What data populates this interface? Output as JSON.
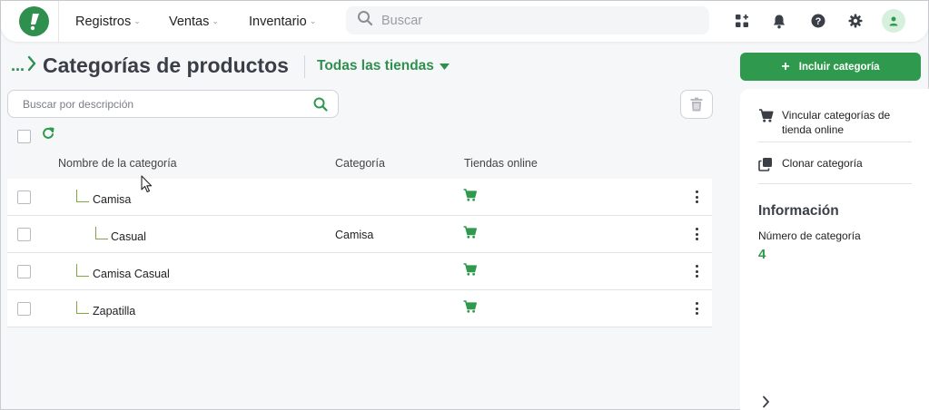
{
  "nav": {
    "items": [
      {
        "label": "Registros"
      },
      {
        "label": "Ventas"
      },
      {
        "label": "Inventario"
      }
    ],
    "search_placeholder": "Buscar"
  },
  "page": {
    "breadcrumb_ellipsis": "...",
    "title": "Categorías de productos",
    "store_filter": "Todas las tiendas"
  },
  "list": {
    "search_placeholder": "Buscar por descripción",
    "columns": [
      "Nombre de la categoría",
      "Categoría",
      "Tiendas online"
    ],
    "rows": [
      {
        "name": "Camisa",
        "level": 1,
        "parent": "",
        "online": true
      },
      {
        "name": "Casual",
        "level": 2,
        "parent": "Camisa",
        "online": true
      },
      {
        "name": "Camisa Casual",
        "level": 1,
        "parent": "",
        "online": true
      },
      {
        "name": "Zapatilla",
        "level": 1,
        "parent": "",
        "online": true
      }
    ]
  },
  "sidebar": {
    "add_button": "Incluir categoría",
    "actions": [
      {
        "label": "Vincular categorías de tienda online",
        "icon": "cart-icon"
      },
      {
        "label": "Clonar categoría",
        "icon": "clone-icon"
      }
    ],
    "info": {
      "title": "Información",
      "label": "Número de categoría",
      "value": "4"
    }
  },
  "colors": {
    "brand": "#2f8f4e",
    "accent": "#2f9a4e",
    "tree_line": "#7ea83d"
  }
}
